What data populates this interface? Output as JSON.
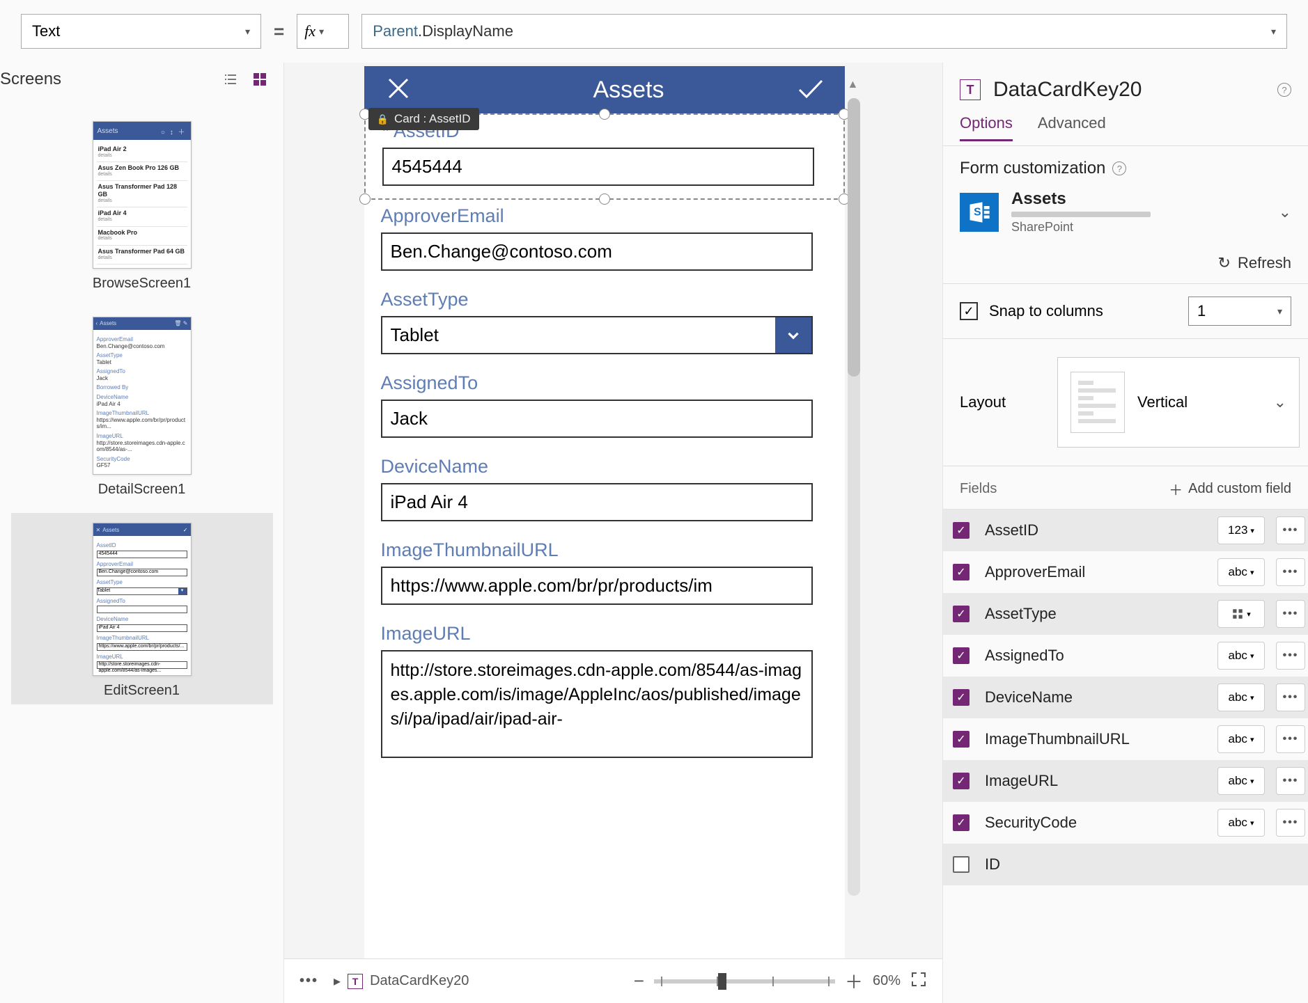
{
  "formulaBar": {
    "propertySelector": "Text",
    "fx": "fx",
    "formula": "Parent.DisplayName"
  },
  "screensPanel": {
    "title": "Screens",
    "screens": [
      {
        "name": "BrowseScreen1"
      },
      {
        "name": "DetailScreen1"
      },
      {
        "name": "EditScreen1"
      }
    ]
  },
  "canvas": {
    "headerTitle": "Assets",
    "selectionTooltip": "Card : AssetID",
    "cards": [
      {
        "label": "AssetID",
        "required": true,
        "value": "4545444",
        "type": "text"
      },
      {
        "label": "ApproverEmail",
        "required": false,
        "value": "Ben.Change@contoso.com",
        "type": "text"
      },
      {
        "label": "AssetType",
        "required": false,
        "value": "Tablet",
        "type": "select"
      },
      {
        "label": "AssignedTo",
        "required": false,
        "value": "Jack",
        "type": "text"
      },
      {
        "label": "DeviceName",
        "required": false,
        "value": "iPad Air 4",
        "type": "text"
      },
      {
        "label": "ImageThumbnailURL",
        "required": false,
        "value": "https://www.apple.com/br/pr/products/im",
        "type": "text"
      },
      {
        "label": "ImageURL",
        "required": false,
        "value": "http://store.storeimages.cdn-apple.com/8544/as-images.apple.com/is/image/AppleInc/aos/published/images/i/pa/ipad/air/ipad-air-",
        "type": "textarea"
      }
    ]
  },
  "rightPanel": {
    "selectedControl": "DataCardKey20",
    "tabs": {
      "options": "Options",
      "advanced": "Advanced"
    },
    "formCustomization": "Form customization",
    "dataSource": {
      "name": "Assets",
      "type": "SharePoint"
    },
    "refresh": "Refresh",
    "snapToColumns": "Snap to columns",
    "snapValue": "1",
    "layout": {
      "label": "Layout",
      "value": "Vertical"
    },
    "fieldsLabel": "Fields",
    "addCustomField": "Add custom field",
    "fields": [
      {
        "name": "AssetID",
        "typeIcon": "123",
        "checked": true
      },
      {
        "name": "ApproverEmail",
        "typeIcon": "abc",
        "checked": true
      },
      {
        "name": "AssetType",
        "typeIcon": "grid",
        "checked": true
      },
      {
        "name": "AssignedTo",
        "typeIcon": "abc",
        "checked": true
      },
      {
        "name": "DeviceName",
        "typeIcon": "abc",
        "checked": true
      },
      {
        "name": "ImageThumbnailURL",
        "typeIcon": "abc",
        "checked": true
      },
      {
        "name": "ImageURL",
        "typeIcon": "abc",
        "checked": true
      },
      {
        "name": "SecurityCode",
        "typeIcon": "abc",
        "checked": true
      },
      {
        "name": "ID",
        "typeIcon": "",
        "checked": false
      }
    ]
  },
  "bottomBar": {
    "selected": "DataCardKey20",
    "zoom": "60%"
  },
  "thumbnails": {
    "browse": {
      "title": "Assets",
      "rows": [
        "iPad Air 2",
        "Asus Zen Book Pro 126 GB",
        "Asus Transformer Pad 128 GB",
        "iPad Air 4",
        "Macbook Pro",
        "Asus Transformer Pad 64 GB"
      ]
    },
    "detail": {
      "title": "Assets",
      "pairs": [
        {
          "k": "ApproverEmail",
          "v": "Ben.Change@contoso.com"
        },
        {
          "k": "AssetType",
          "v": "Tablet"
        },
        {
          "k": "AssignedTo",
          "v": "Jack"
        },
        {
          "k": "Borrowed By",
          "v": ""
        },
        {
          "k": "DeviceName",
          "v": "iPad Air 4"
        },
        {
          "k": "ImageThumbnailURL",
          "v": "https://www.apple.com/br/pr/products/im..."
        },
        {
          "k": "ImageURL",
          "v": "http://store.storeimages.cdn-apple.com/8544/as-..."
        },
        {
          "k": "SecurityCode",
          "v": "GF57"
        }
      ]
    },
    "edit": {
      "title": "Assets",
      "fields": [
        {
          "k": "AssetID",
          "v": "4545444"
        },
        {
          "k": "ApproverEmail",
          "v": "Ben.Change@contoso.com"
        },
        {
          "k": "AssetType",
          "v": "Tablet",
          "select": true
        },
        {
          "k": "AssignedTo",
          "v": ""
        },
        {
          "k": "DeviceName",
          "v": "iPad Air 4"
        },
        {
          "k": "ImageThumbnailURL",
          "v": "https://www.apple.com/br/pr/products/..."
        },
        {
          "k": "ImageURL",
          "v": "http://store.storeimages.cdn-apple.com/8544/as-images..."
        }
      ]
    }
  }
}
